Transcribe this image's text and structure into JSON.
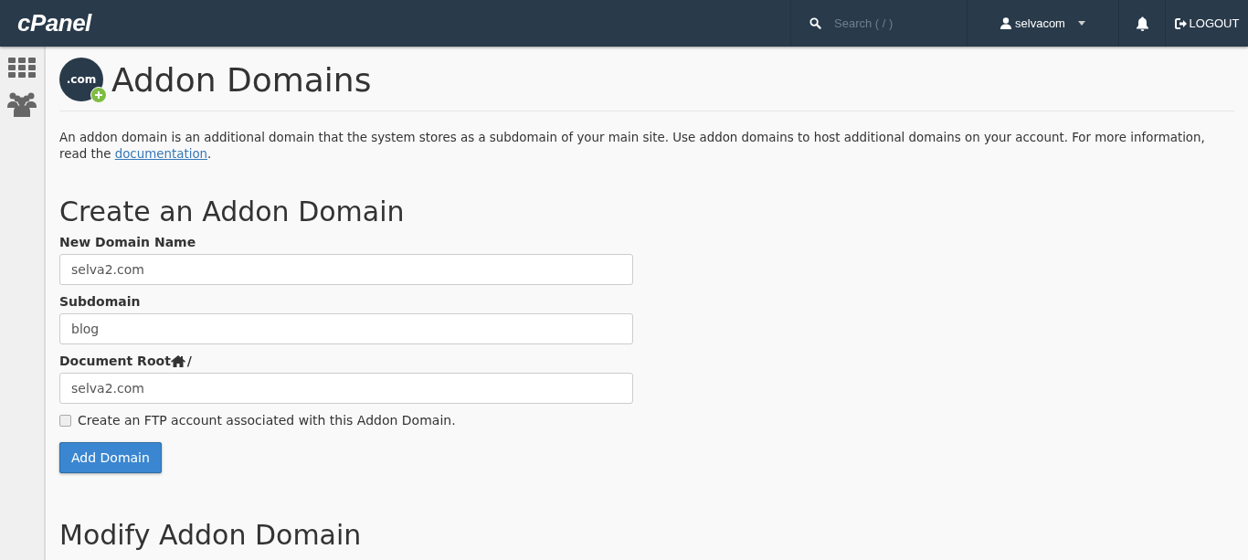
{
  "header": {
    "logo": "cPanel",
    "search": {
      "placeholder": "Search ( / )"
    },
    "user": "selvacom",
    "logout": "LOGOUT"
  },
  "page": {
    "icon_text": ".com",
    "title": "Addon Domains",
    "description": "An addon domain is an additional domain that the system stores as a subdomain of your main site. Use addon domains to host additional domains on your account. For more information, read the",
    "link": "documentation",
    "description_end": "."
  },
  "create": {
    "title": "Create an Addon Domain",
    "fields": [
      {
        "label": "New Domain Name",
        "value": "selva2.com"
      },
      {
        "label": "Subdomain",
        "value": "blog"
      },
      {
        "label": "Document Root",
        "suffix": "/",
        "home_icon": true,
        "value": "selva2.com"
      }
    ],
    "ftp_checkbox": {
      "label": "Create an FTP account associated with this Addon Domain.",
      "checked": false
    },
    "button": "Add Domain"
  },
  "modify": {
    "title": "Modify Addon Domain"
  }
}
